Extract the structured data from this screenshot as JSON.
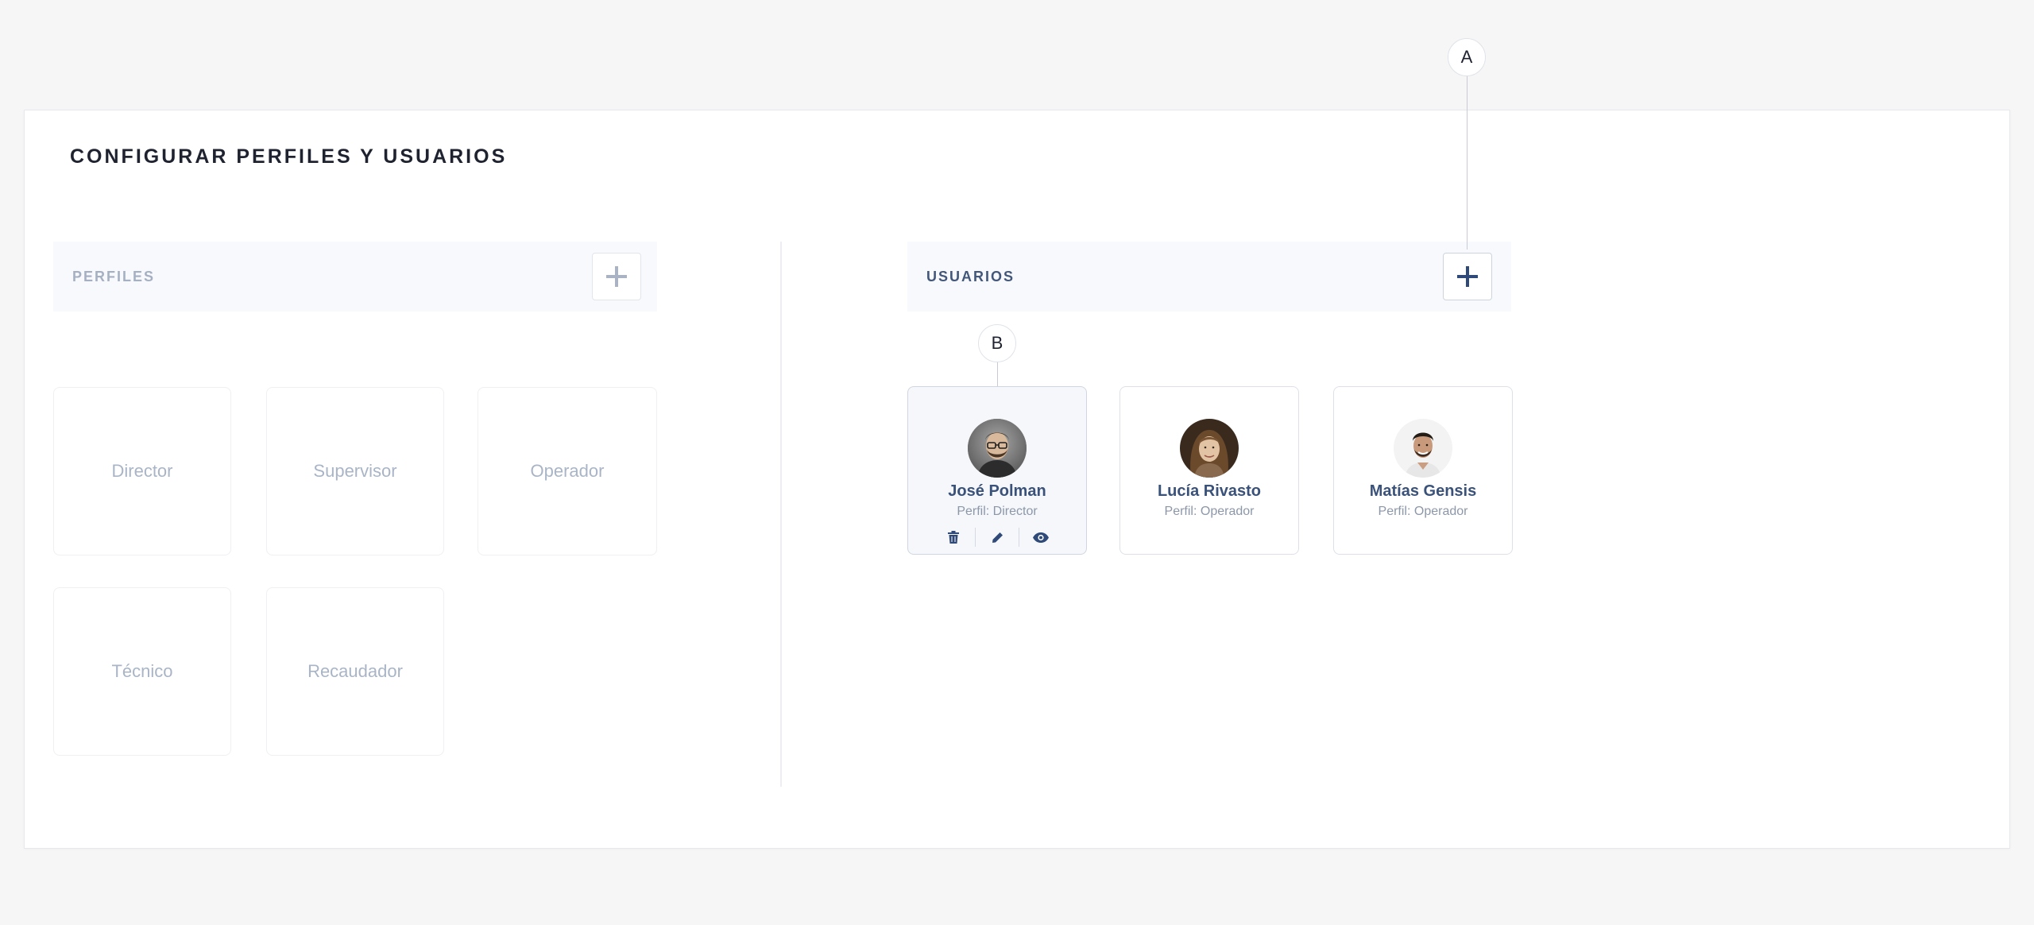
{
  "page": {
    "title": "CONFIGURAR PERFILES Y USUARIOS"
  },
  "perfiles": {
    "label": "PERFILES",
    "items": [
      {
        "label": "Director"
      },
      {
        "label": "Supervisor"
      },
      {
        "label": "Operador"
      },
      {
        "label": "Técnico"
      },
      {
        "label": "Recaudador"
      }
    ]
  },
  "usuarios": {
    "label": "USUARIOS",
    "items": [
      {
        "name": "José Polman",
        "profile": "Perfil: Director",
        "selected": true
      },
      {
        "name": "Lucía Rivasto",
        "profile": "Perfil: Operador",
        "selected": false
      },
      {
        "name": "Matías Gensis",
        "profile": "Perfil: Operador",
        "selected": false
      }
    ]
  },
  "markers": {
    "a": "A",
    "b": "B"
  },
  "icons": {
    "add": "plus-icon",
    "delete": "trash-icon",
    "edit": "pencil-icon",
    "view": "eye-icon"
  },
  "colors": {
    "accent": "#2f4a78",
    "muted_text": "#a9b5c6",
    "user_name": "#3a5279"
  }
}
